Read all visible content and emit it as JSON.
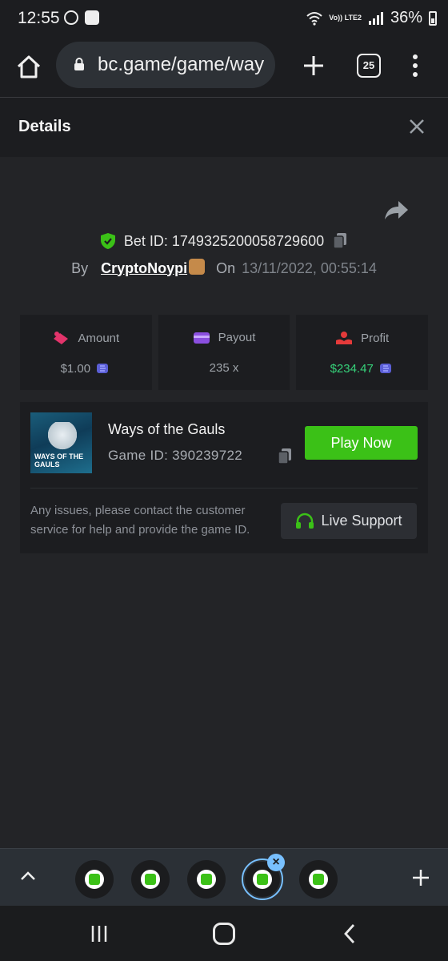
{
  "status_bar": {
    "time": "12:55",
    "network": "Vo)) LTE2",
    "battery": "36%"
  },
  "browser": {
    "url": "bc.game/game/way",
    "tab_count": "25"
  },
  "details": {
    "title": "Details"
  },
  "bet": {
    "id_label": "Bet ID: 1749325200058729600",
    "by_label": "By",
    "username": "CryptoNoypi",
    "on_label": "On",
    "datetime": "13/11/2022, 00:55:14"
  },
  "stats": {
    "amount_label": "Amount",
    "amount_value": "$1.00",
    "payout_label": "Payout",
    "payout_value": "235 x",
    "profit_label": "Profit",
    "profit_value": "$234.47"
  },
  "game": {
    "thumb_text": "WAYS OF THE GAULS",
    "name": "Ways of the Gauls",
    "game_id": "Game ID: 390239722",
    "play_label": "Play Now",
    "issue_text": "Any issues, please contact the customer service for help and provide the game ID.",
    "support_label": "Live Support"
  },
  "colors": {
    "accent_green": "#3bc117",
    "profit_green": "#36d27a",
    "active_tab": "#78c0ff"
  },
  "icons": [
    "home-icon",
    "lock-icon",
    "plus-icon",
    "tabs-icon",
    "menu-icon",
    "close-icon",
    "share-icon",
    "shield-icon",
    "copy-icon",
    "amount-icon",
    "payout-icon",
    "profit-icon",
    "coin-icon",
    "headset-icon",
    "chevron-up-icon"
  ]
}
